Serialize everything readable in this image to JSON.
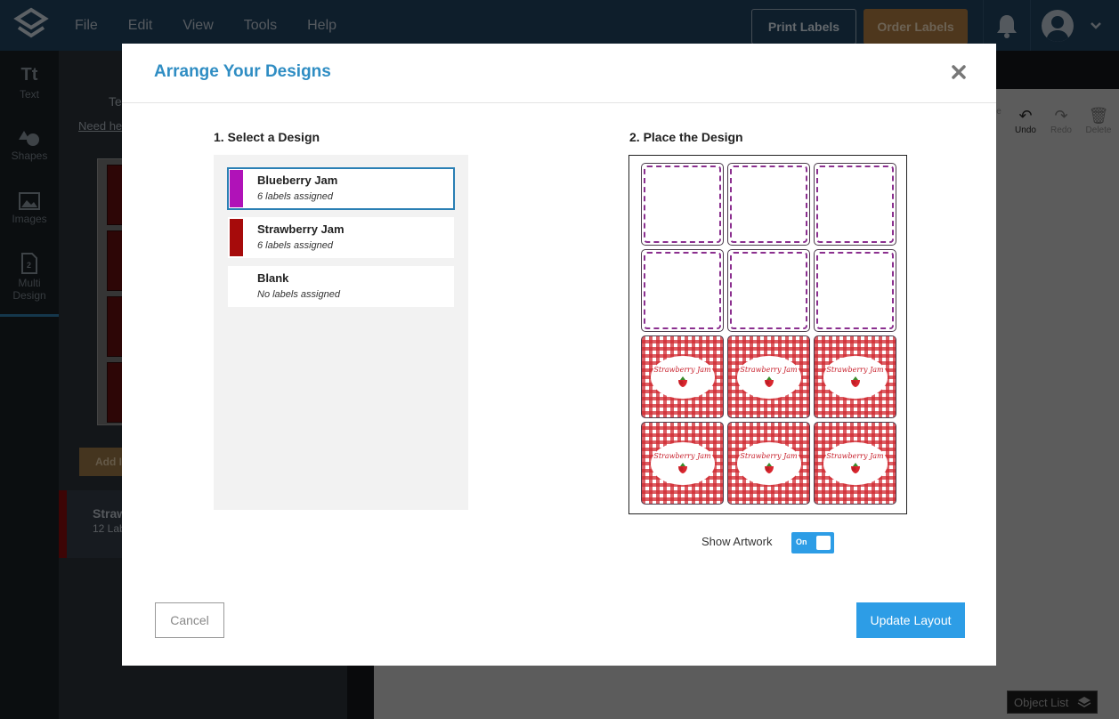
{
  "menu": [
    "File",
    "Edit",
    "View",
    "Tools",
    "Help"
  ],
  "header": {
    "print_labels": "Print Labels",
    "order_labels": "Order Labels"
  },
  "sidebar": [
    {
      "icon": "text-icon",
      "glyph": "Tt",
      "label": "Text"
    },
    {
      "icon": "shapes-icon",
      "glyph": "",
      "label": "Shapes"
    },
    {
      "icon": "images-icon",
      "glyph": "",
      "label": "Images"
    },
    {
      "icon": "multi-design-icon",
      "glyph": "",
      "label": "Multi Design"
    }
  ],
  "panel": {
    "title_partial": "Te",
    "help_partial": "Need he",
    "add_partial": "Add I",
    "entry_name_partial": "Straw",
    "entry_count_partial": "12 Lab"
  },
  "toolbar": {
    "undo": "Undo",
    "redo": "Redo",
    "delete": "Delete",
    "partial_left": "e"
  },
  "object_list": "Object List",
  "modal": {
    "title": "Arrange Your Designs",
    "step1": "1. Select a Design",
    "step2": "2. Place the Design",
    "designs": [
      {
        "name": "Blueberry Jam",
        "count": "6 labels assigned",
        "color": "#b012b8",
        "selected": true
      },
      {
        "name": "Strawberry Jam",
        "count": "6 labels assigned",
        "color": "#a60b0b",
        "selected": false
      },
      {
        "name": "Blank",
        "count": "No labels assigned",
        "color": "",
        "selected": false
      }
    ],
    "sheet": {
      "rows": 4,
      "cols": 3,
      "cells": [
        "empty",
        "empty",
        "empty",
        "empty",
        "empty",
        "empty",
        "art",
        "art",
        "art",
        "art",
        "art",
        "art"
      ],
      "art_text": "Strawberry Jam"
    },
    "show_artwork_label": "Show Artwork",
    "toggle_label": "On",
    "cancel": "Cancel",
    "update": "Update Layout"
  },
  "colors": {
    "accent": "#2d9de6",
    "title": "#2f8dc3",
    "dashed": "#8b2f8f",
    "gingham": "#d02830"
  }
}
